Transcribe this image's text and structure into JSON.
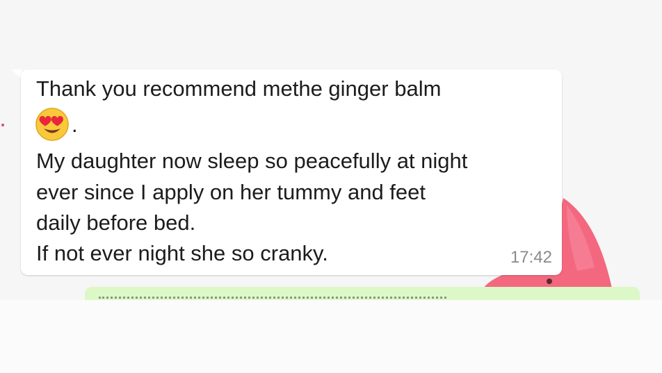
{
  "message": {
    "lines": [
      "Thank you recommend methe ginger balm",
      "My daughter now sleep so peacefully at night",
      "ever since I apply on her tummy and feet",
      "daily before bed.",
      "If not ever night she so cranky."
    ],
    "emoji_icon": "heart-eyes-emoji",
    "emoji_suffix": ".",
    "time": "17:42"
  },
  "colors": {
    "incoming_bubble": "#ffffff",
    "outgoing_bubble": "#dcf8c6",
    "sticker_pink": "#f0647f",
    "timestamp": "#8a8a8a"
  }
}
